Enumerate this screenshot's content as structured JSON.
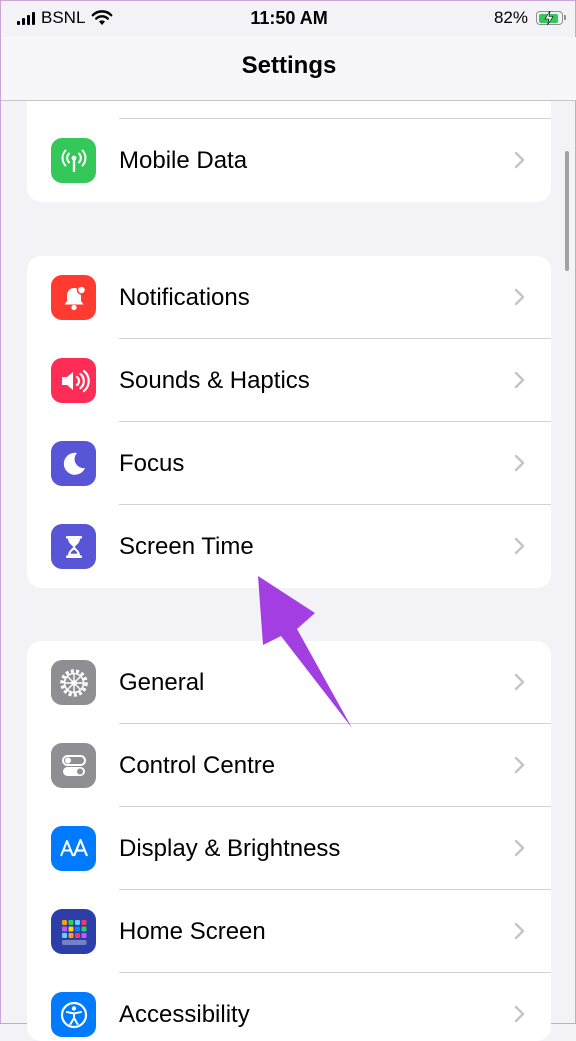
{
  "status_bar": {
    "carrier": "BSNL",
    "time": "11:50 AM",
    "battery_percent": "82%",
    "battery_level": 0.82,
    "icons": [
      "signal-icon",
      "wifi-icon",
      "battery-charging-icon"
    ]
  },
  "header": {
    "title": "Settings"
  },
  "groups": [
    {
      "rows": [
        {
          "label": "Mobile Data",
          "icon": "antenna-icon",
          "color": "#34c759"
        }
      ]
    },
    {
      "rows": [
        {
          "label": "Notifications",
          "icon": "bell-icon",
          "color": "#ff3b30"
        },
        {
          "label": "Sounds & Haptics",
          "icon": "speaker-icon",
          "color": "#ff2d55"
        },
        {
          "label": "Focus",
          "icon": "moon-icon",
          "color": "#5856d6"
        },
        {
          "label": "Screen Time",
          "icon": "hourglass-icon",
          "color": "#5856d6"
        }
      ]
    },
    {
      "rows": [
        {
          "label": "General",
          "icon": "gear-icon",
          "color": "#8e8e93"
        },
        {
          "label": "Control Centre",
          "icon": "toggles-icon",
          "color": "#8e8e93"
        },
        {
          "label": "Display & Brightness",
          "icon": "text-size-icon",
          "color": "#007aff"
        },
        {
          "label": "Home Screen",
          "icon": "app-grid-icon",
          "color": "#2c3ea8"
        },
        {
          "label": "Accessibility",
          "icon": "accessibility-icon",
          "color": "#007aff"
        }
      ]
    }
  ],
  "annotation": {
    "icon": "pointer-arrow-icon",
    "color": "#a33fe0",
    "points_to": "Screen Time"
  }
}
